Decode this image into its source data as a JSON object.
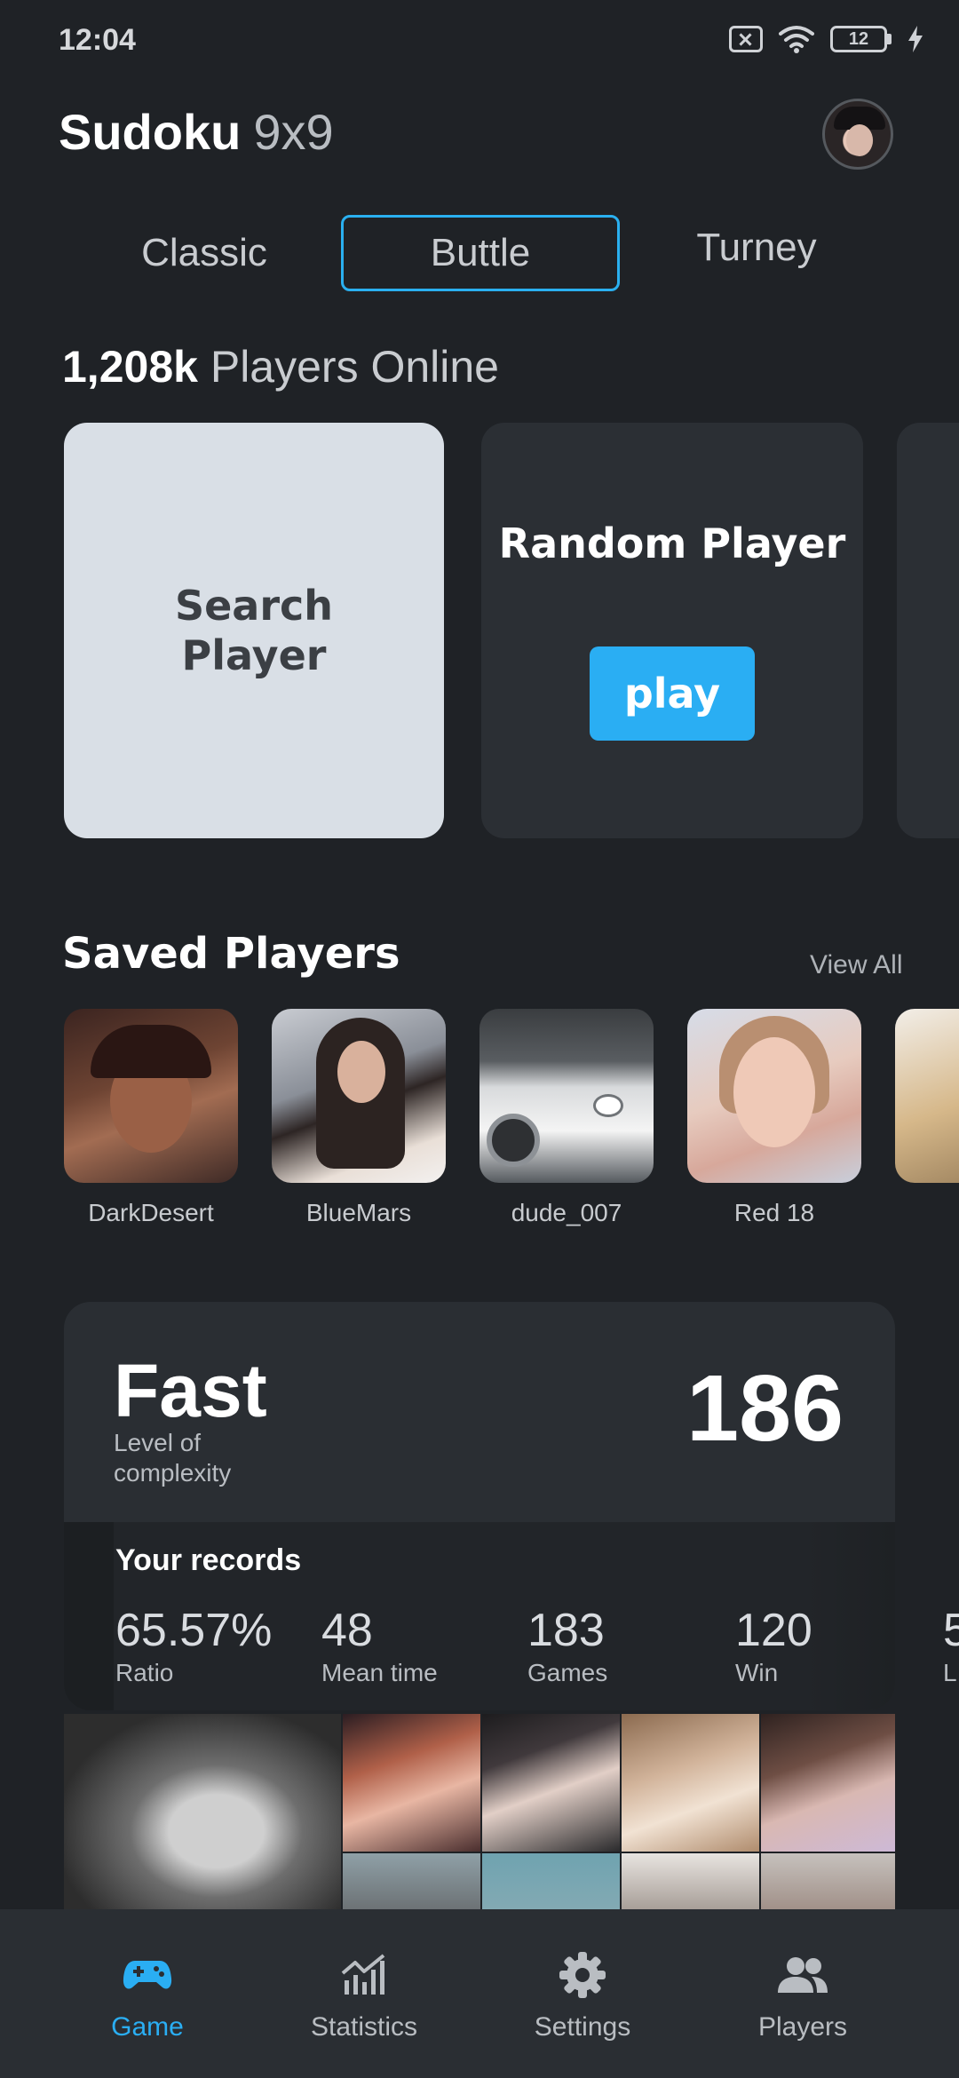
{
  "status_bar": {
    "time": "12:04",
    "battery_level": "12",
    "icons": [
      "sim-off-icon",
      "wifi-icon",
      "battery-icon",
      "charging-icon"
    ]
  },
  "header": {
    "title_main": "Sudoku",
    "title_sub": "9x9",
    "avatar_icon": "profile-avatar"
  },
  "tabs": [
    {
      "label": "Classic",
      "selected": false
    },
    {
      "label": "Buttle",
      "selected": true
    },
    {
      "label": "Turney",
      "selected": false
    }
  ],
  "online": {
    "count": "1,208k",
    "label": "Players Online"
  },
  "cards": {
    "search_label": "Search Player",
    "random_label": "Random Player",
    "play_label": "play"
  },
  "saved_players": {
    "title": "Saved Players",
    "view_all": "View All",
    "items": [
      {
        "name": "DarkDesert"
      },
      {
        "name": "BlueMars"
      },
      {
        "name": "dude_007"
      },
      {
        "name": "Red 18"
      }
    ]
  },
  "stats": {
    "level_title": "Fast",
    "level_sub": "Level of complexity",
    "big_number": "186",
    "records_title": "Your records",
    "records": [
      {
        "value": "65.57%",
        "label": "Ratio"
      },
      {
        "value": "48",
        "label": "Mean time"
      },
      {
        "value": "183",
        "label": "Games"
      },
      {
        "value": "120",
        "label": "Win"
      },
      {
        "value": "5",
        "label": "L"
      }
    ]
  },
  "nav": [
    {
      "label": "Game",
      "icon": "gamepad-icon",
      "active": true
    },
    {
      "label": "Statistics",
      "icon": "chart-icon",
      "active": false
    },
    {
      "label": "Settings",
      "icon": "gear-icon",
      "active": false
    },
    {
      "label": "Players",
      "icon": "people-icon",
      "active": false
    }
  ],
  "colors": {
    "accent": "#2aaef3",
    "background": "#1f2226",
    "card": "#2b2f34",
    "search_card": "#d9dfe6"
  }
}
